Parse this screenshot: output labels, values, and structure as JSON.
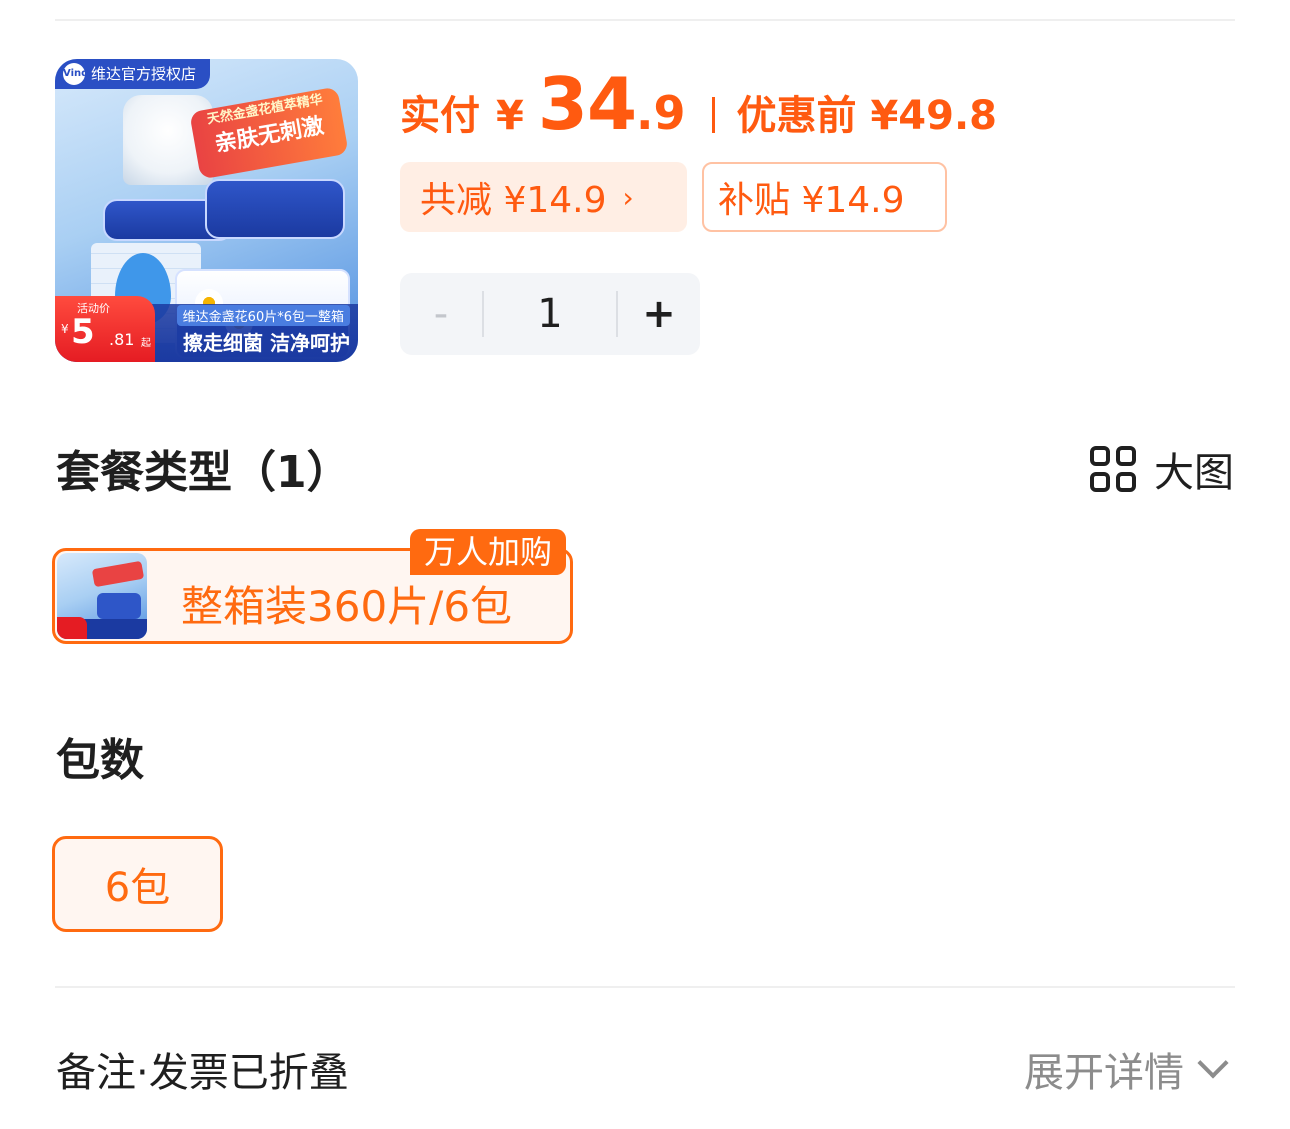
{
  "product": {
    "shop_label": "维达官方授权店",
    "brand_logo": "Vinda",
    "promo_line1": "天然金盏花植萃精华",
    "promo_line2": "亲肤无刺激",
    "package_caption": "维达金盏花60片*6包一整箱",
    "slogan": "擦走细菌 洁净呵护",
    "activity_label": "活动价",
    "activity_currency": "¥",
    "activity_int": "5",
    "activity_dec": ".81",
    "activity_suffix": "起"
  },
  "price": {
    "paid_label": "实付",
    "currency": "¥",
    "paid_int": "34",
    "paid_dec": ".9",
    "before_text": "优惠前 ¥49.8"
  },
  "chips": {
    "reduce_text": "共减 ¥14.9",
    "reduce_arrow": "›",
    "subsidy_text": "补贴 ¥14.9"
  },
  "stepper": {
    "minus": "-",
    "quantity": "1",
    "plus": "+"
  },
  "combo_section": {
    "title": "套餐类型（1）",
    "view_toggle_label": "大图",
    "options": [
      {
        "label": "整箱装360片/6包",
        "badge": "万人加购",
        "selected": true
      }
    ]
  },
  "pack_section": {
    "title": "包数",
    "options": [
      {
        "label": "6包",
        "selected": true
      }
    ]
  },
  "footer": {
    "note_label": "备注·发票已折叠",
    "expand_label": "展开详情"
  },
  "colors": {
    "accent": "#ff5a10",
    "chip_bg": "#ffeee4",
    "option_border": "#ff6a10"
  },
  "icons": {
    "view_toggle": "grid-icon",
    "expand": "chevron-down-icon",
    "reduce_arrow": "chevron-right-icon"
  }
}
